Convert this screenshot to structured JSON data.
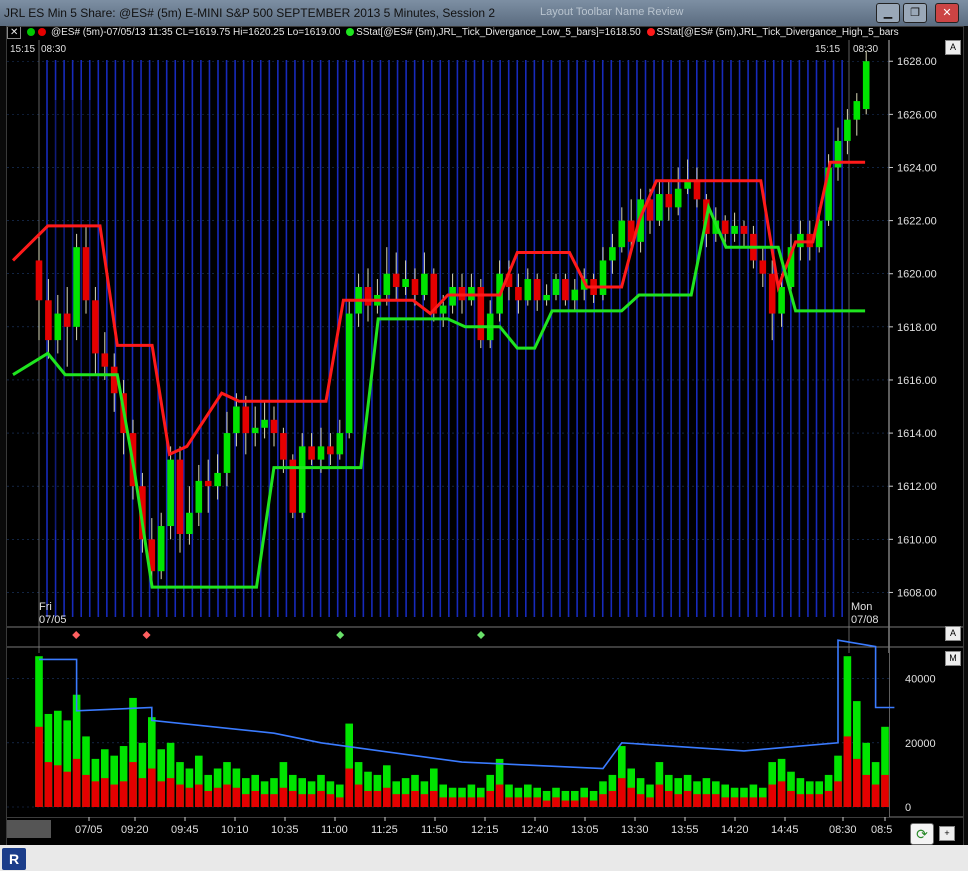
{
  "window": {
    "title": "JRL ES Min 5 Share: @ES# (5m) E-MINI S&P 500 SEPTEMBER 2013 5 Minutes, Session 2",
    "faint_tabs": "Layout Toolbar  Name Review",
    "minimize": "▁",
    "restore": "❐",
    "close": "✕"
  },
  "legend": {
    "symbol_info": "@ES# (5m)-07/05/13 11:35 CL=1619.75 Hi=1620.25 Lo=1619.00",
    "study_low": "SStat[@ES# (5m),JRL_Tick_Divergance_Low_5_bars]=1618.50",
    "study_high": "SStat[@ES# (5m),JRL_Tick_Divergance_High_5_bars",
    "time_left": "15:15",
    "time_left2": "08:30",
    "time_right": "15:15",
    "time_right2": "08:30",
    "colors": {
      "up": "#00e400",
      "down": "#e40000",
      "study_low": "#1fe51f",
      "study_high": "#ff1a1a"
    }
  },
  "date_labels": {
    "left_day": "Fri",
    "left_date": "07/05",
    "right_day": "Mon",
    "right_date": "07/08"
  },
  "price_axis": [
    "1628.00",
    "1626.00",
    "1624.00",
    "1622.00",
    "1620.00",
    "1618.00",
    "1616.00",
    "1614.00",
    "1612.00",
    "1610.00",
    "1608.00"
  ],
  "volume_axis": [
    "40000",
    "20000",
    "0"
  ],
  "time_axis": [
    "07/05",
    "09:20",
    "09:45",
    "10:10",
    "10:35",
    "11:00",
    "11:25",
    "11:50",
    "12:15",
    "12:40",
    "13:05",
    "13:30",
    "13:55",
    "14:20",
    "14:45",
    "08:30",
    "08:5"
  ],
  "controls": {
    "a_top": "A",
    "a_mid": "A",
    "m": "M",
    "refresh": "⟳",
    "plus": "+",
    "logo": "R"
  },
  "chart_data": {
    "type": "candlestick",
    "ylim": [
      1607,
      1628.8
    ],
    "volume_ylim": [
      0,
      48000
    ],
    "candles": [
      [
        1620.5,
        1619,
        1621.5,
        1617.5
      ],
      [
        1619,
        1617.5,
        1619.8,
        1616.8
      ],
      [
        1617.5,
        1618.5,
        1619.2,
        1617
      ],
      [
        1618.5,
        1618,
        1619.5,
        1616.5
      ],
      [
        1618,
        1621,
        1621.5,
        1617.5
      ],
      [
        1621,
        1619,
        1621.8,
        1618.5
      ],
      [
        1619,
        1617,
        1619.5,
        1616.2
      ],
      [
        1617,
        1616.5,
        1617.8,
        1616
      ],
      [
        1616.5,
        1615.5,
        1617,
        1614.8
      ],
      [
        1615.5,
        1614,
        1616,
        1613.2
      ],
      [
        1614,
        1612,
        1614.5,
        1611.5
      ],
      [
        1612,
        1610,
        1612.5,
        1609.5
      ],
      [
        1610,
        1608.8,
        1610.8,
        1608.2
      ],
      [
        1608.8,
        1610.5,
        1611,
        1608.5
      ],
      [
        1610.5,
        1613,
        1613.5,
        1610
      ],
      [
        1613,
        1610.2,
        1613.5,
        1609.5
      ],
      [
        1610.2,
        1611,
        1612,
        1609.8
      ],
      [
        1611,
        1612.2,
        1612.8,
        1610.5
      ],
      [
        1612.2,
        1612,
        1613,
        1611
      ],
      [
        1612,
        1612.5,
        1613.2,
        1611.5
      ],
      [
        1612.5,
        1614,
        1614.8,
        1612
      ],
      [
        1614,
        1615,
        1615.5,
        1613.5
      ],
      [
        1615,
        1614,
        1615.4,
        1613.2
      ],
      [
        1614,
        1614.2,
        1615,
        1613.5
      ],
      [
        1614.2,
        1614.5,
        1615.2,
        1613.8
      ],
      [
        1614.5,
        1614,
        1615,
        1613.5
      ],
      [
        1614,
        1613,
        1614.2,
        1612.5
      ],
      [
        1613,
        1611,
        1613.2,
        1610.8
      ],
      [
        1611,
        1613.5,
        1614,
        1610.8
      ],
      [
        1613.5,
        1613,
        1614,
        1612.8
      ],
      [
        1613,
        1613.5,
        1614.2,
        1612.5
      ],
      [
        1613.5,
        1613.2,
        1614,
        1612.8
      ],
      [
        1613.2,
        1614,
        1614.5,
        1613
      ],
      [
        1614,
        1618.5,
        1619,
        1613.8
      ],
      [
        1618.5,
        1619.5,
        1620,
        1618
      ],
      [
        1619.5,
        1618.8,
        1620.2,
        1618.2
      ],
      [
        1618.8,
        1619.2,
        1619.8,
        1618.5
      ],
      [
        1619.2,
        1620,
        1621,
        1618.8
      ],
      [
        1620,
        1619.5,
        1620.8,
        1619
      ],
      [
        1619.5,
        1619.8,
        1620.5,
        1619.2
      ],
      [
        1619.8,
        1619.2,
        1620.2,
        1618.8
      ],
      [
        1619.2,
        1620,
        1620.8,
        1619
      ],
      [
        1620,
        1618.5,
        1620.2,
        1618.2
      ],
      [
        1618.5,
        1618.8,
        1619.2,
        1618
      ],
      [
        1618.8,
        1619.5,
        1620,
        1618.5
      ],
      [
        1619.5,
        1619,
        1620,
        1618.5
      ],
      [
        1619,
        1619.5,
        1620,
        1618.8
      ],
      [
        1619.5,
        1617.5,
        1619.8,
        1617.2
      ],
      [
        1617.5,
        1618.5,
        1619,
        1617.2
      ],
      [
        1618.5,
        1620,
        1620.5,
        1618.2
      ],
      [
        1620,
        1619.5,
        1620.5,
        1619
      ],
      [
        1619.5,
        1619,
        1620,
        1618.5
      ],
      [
        1619,
        1619.8,
        1620.2,
        1618.8
      ],
      [
        1619.8,
        1619,
        1620,
        1618.6
      ],
      [
        1619,
        1619.2,
        1619.6,
        1618.8
      ],
      [
        1619.2,
        1619.8,
        1620,
        1619
      ],
      [
        1619.8,
        1619,
        1620,
        1618.8
      ],
      [
        1619,
        1619.4,
        1619.8,
        1618.6
      ],
      [
        1619.4,
        1619.8,
        1620.2,
        1619
      ],
      [
        1619.8,
        1619.2,
        1620,
        1618.9
      ],
      [
        1619.2,
        1620.5,
        1621,
        1619
      ],
      [
        1620.5,
        1621,
        1621.5,
        1620
      ],
      [
        1621,
        1622,
        1622.5,
        1620.8
      ],
      [
        1622,
        1621.2,
        1622.8,
        1621
      ],
      [
        1621.2,
        1622.8,
        1623.2,
        1620.8
      ],
      [
        1622.8,
        1622,
        1623.2,
        1621.5
      ],
      [
        1622,
        1623,
        1623.5,
        1621.8
      ],
      [
        1623,
        1622.5,
        1623.5,
        1622
      ],
      [
        1622.5,
        1623.2,
        1624,
        1622.2
      ],
      [
        1623.2,
        1623.5,
        1624.3,
        1623
      ],
      [
        1623.5,
        1622.8,
        1624,
        1622.5
      ],
      [
        1622.8,
        1621.5,
        1623,
        1621
      ],
      [
        1621.5,
        1622,
        1622.5,
        1621.2
      ],
      [
        1622,
        1621.5,
        1622.2,
        1621
      ],
      [
        1621.5,
        1621.8,
        1622.3,
        1621.2
      ],
      [
        1621.8,
        1621.5,
        1622,
        1621
      ],
      [
        1621.5,
        1620.5,
        1621.8,
        1620.2
      ],
      [
        1620.5,
        1620,
        1621,
        1619.5
      ],
      [
        1620,
        1618.5,
        1620.5,
        1617.5
      ],
      [
        1618.5,
        1619.5,
        1620,
        1618
      ],
      [
        1619.5,
        1621,
        1621.5,
        1619.2
      ],
      [
        1621,
        1621.5,
        1622,
        1620.5
      ],
      [
        1621.5,
        1621,
        1622,
        1620.5
      ],
      [
        1621,
        1622,
        1622.5,
        1620.8
      ],
      [
        1622,
        1624,
        1624.5,
        1621.8
      ],
      [
        1624,
        1625,
        1625.5,
        1623.5
      ],
      [
        1625,
        1625.8,
        1626.2,
        1624.5
      ],
      [
        1625.8,
        1626.5,
        1626.8,
        1625.2
      ],
      [
        1626.2,
        1628,
        1628.4,
        1626
      ]
    ],
    "volume_up": [
      47000,
      29000,
      30000,
      27000,
      35000,
      22000,
      15000,
      18000,
      16000,
      19000,
      34000,
      20000,
      28000,
      18000,
      20000,
      14000,
      12000,
      16000,
      10000,
      12000,
      14000,
      12000,
      9000,
      10000,
      8000,
      9000,
      14000,
      10000,
      9000,
      8000,
      10000,
      8000,
      7000,
      26000,
      14000,
      11000,
      10000,
      13000,
      8000,
      9000,
      10000,
      8000,
      12000,
      7000,
      6000,
      6000,
      7000,
      6000,
      10000,
      15000,
      7000,
      6000,
      7000,
      6000,
      5000,
      6000,
      5000,
      5000,
      6000,
      5000,
      8000,
      10000,
      19000,
      12000,
      9000,
      7000,
      14000,
      10000,
      9000,
      10000,
      8000,
      9000,
      8000,
      7000,
      6000,
      6000,
      7000,
      6000,
      14000,
      15000,
      11000,
      9000,
      8000,
      8000,
      10000,
      16000,
      47000,
      33000,
      20000,
      14000,
      25000
    ],
    "volume_down": [
      25000,
      14000,
      13000,
      11000,
      15000,
      10000,
      8000,
      9000,
      7000,
      8000,
      14000,
      9000,
      12000,
      8000,
      9000,
      7000,
      6000,
      7000,
      5000,
      6000,
      7000,
      6000,
      4000,
      5000,
      4000,
      4000,
      6000,
      5000,
      4000,
      4000,
      5000,
      4000,
      3000,
      12000,
      7000,
      5000,
      5000,
      6000,
      4000,
      4000,
      5000,
      4000,
      5000,
      3000,
      3000,
      3000,
      3000,
      3000,
      5000,
      7000,
      3000,
      3000,
      3000,
      3000,
      2000,
      3000,
      2000,
      2000,
      3000,
      2000,
      4000,
      5000,
      9000,
      6000,
      4000,
      3000,
      7000,
      5000,
      4000,
      5000,
      4000,
      4000,
      4000,
      3000,
      3000,
      3000,
      3000,
      3000,
      7000,
      8000,
      5000,
      4000,
      4000,
      4000,
      5000,
      8000,
      22000,
      15000,
      10000,
      7000,
      10000
    ],
    "volume_avg": [
      [
        0,
        46000
      ],
      [
        4,
        46000
      ],
      [
        4,
        30000
      ],
      [
        12,
        31000
      ],
      [
        12,
        27000
      ],
      [
        25,
        23000
      ],
      [
        30,
        20000
      ],
      [
        45,
        14000
      ],
      [
        60,
        12000
      ],
      [
        62,
        20000
      ],
      [
        75,
        17500
      ],
      [
        77,
        18000
      ],
      [
        85,
        20000
      ],
      [
        85,
        52000
      ],
      [
        89,
        50000
      ],
      [
        89,
        31000
      ],
      [
        91,
        31000
      ]
    ],
    "study_high": [
      [
        0,
        1620.5
      ],
      [
        4,
        1621.8
      ],
      [
        10,
        1621.8
      ],
      [
        12,
        1617.3
      ],
      [
        16,
        1617.3
      ],
      [
        18,
        1613.2
      ],
      [
        20,
        1613.5
      ],
      [
        24,
        1615.5
      ],
      [
        26,
        1615.2
      ],
      [
        36,
        1615.2
      ],
      [
        38,
        1619
      ],
      [
        44,
        1619
      ],
      [
        46,
        1619
      ],
      [
        48,
        1618.5
      ],
      [
        50,
        1619.2
      ],
      [
        56,
        1619.2
      ],
      [
        58,
        1620.8
      ],
      [
        64,
        1620.8
      ],
      [
        66,
        1619.5
      ],
      [
        70,
        1619.5
      ],
      [
        72,
        1622
      ],
      [
        74,
        1623.5
      ],
      [
        86,
        1623.5
      ],
      [
        88,
        1619.5
      ],
      [
        90,
        1621.2
      ],
      [
        92,
        1621.2
      ],
      [
        94,
        1624.2
      ],
      [
        98,
        1624.2
      ]
    ],
    "study_low": [
      [
        0,
        1616.2
      ],
      [
        4,
        1617
      ],
      [
        6,
        1616.2
      ],
      [
        12,
        1616.2
      ],
      [
        14,
        1612.5
      ],
      [
        16,
        1608.2
      ],
      [
        28,
        1608.2
      ],
      [
        30,
        1612.7
      ],
      [
        40,
        1612.7
      ],
      [
        42,
        1618.3
      ],
      [
        50,
        1618.3
      ],
      [
        52,
        1618
      ],
      [
        56,
        1618
      ],
      [
        58,
        1617.2
      ],
      [
        60,
        1617.2
      ],
      [
        62,
        1618.6
      ],
      [
        70,
        1618.6
      ],
      [
        72,
        1619.2
      ],
      [
        78,
        1619.2
      ],
      [
        80,
        1622.5
      ],
      [
        82,
        1621
      ],
      [
        88,
        1621
      ],
      [
        90,
        1618.6
      ],
      [
        98,
        1618.6
      ]
    ],
    "markers": [
      {
        "x": 0.04,
        "color": "#ff6060"
      },
      {
        "x": 0.12,
        "color": "#ff6060"
      },
      {
        "x": 0.34,
        "color": "#6ae06a"
      },
      {
        "x": 0.5,
        "color": "#6ae06a"
      }
    ]
  }
}
